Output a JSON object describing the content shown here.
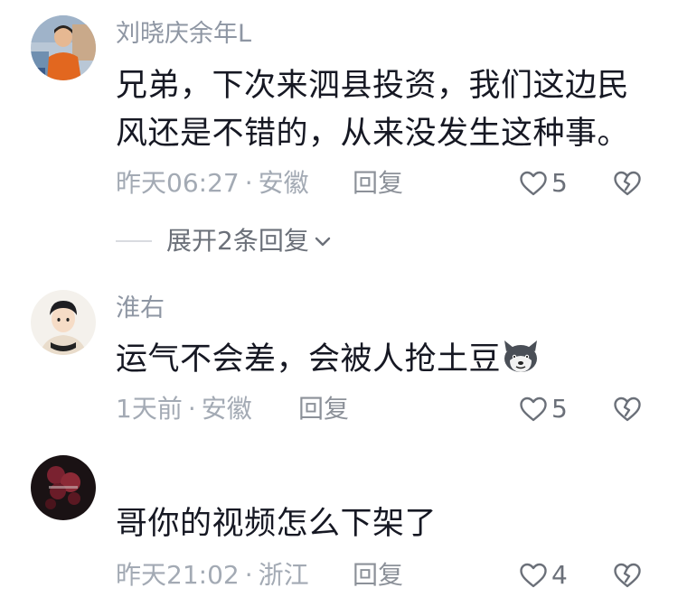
{
  "comments": [
    {
      "username": "刘晓庆余年L",
      "text": "兄弟，下次来泗县投资，我们这边民风还是不错的，从来没发生这种事。",
      "time": "昨天06:27",
      "location": "安徽",
      "reply_label": "回复",
      "likes": "5",
      "expand_label": "展开2条回复"
    },
    {
      "username": "淮右",
      "text": "运气不会差，会被人抢土豆",
      "time": "1天前",
      "location": "安徽",
      "reply_label": "回复",
      "likes": "5"
    },
    {
      "username": "",
      "text": "哥你的视频怎么下架了",
      "time": "昨天21:02",
      "location": "浙江",
      "reply_label": "回复",
      "likes": "4"
    }
  ],
  "separator": "·",
  "icons": {
    "like": "heart-outline-icon",
    "dislike": "broken-heart-icon",
    "expand": "chevron-down-icon",
    "emoji": "husky-dog-emoji-icon"
  },
  "colors": {
    "text": "#161823",
    "username": "#8e96a3",
    "meta": "#a3aab4"
  }
}
